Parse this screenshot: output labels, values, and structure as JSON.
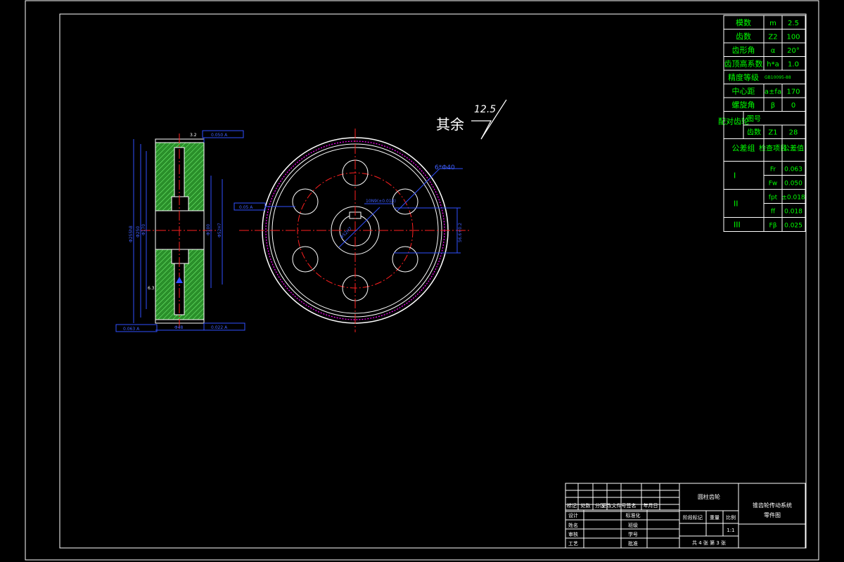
{
  "colors": {
    "background": "#000000",
    "outline": "#ffffff",
    "centerline": "#ff2020",
    "dimension": "#3050ff",
    "table_text": "#00ff00",
    "section_fill": "#33aa33",
    "addendum_circle": "#ff00ff"
  },
  "roughness": {
    "label": "其余",
    "value": "12.5"
  },
  "param_table": {
    "rows": [
      {
        "name": "模数",
        "symbol": "m",
        "value": "2.5"
      },
      {
        "name": "齿数",
        "symbol": "Z2",
        "value": "100"
      },
      {
        "name": "齿形角",
        "symbol": "α",
        "value": "20°"
      },
      {
        "name": "齿顶高系数",
        "symbol": "h*a",
        "value": "1.0"
      },
      {
        "name": "精度等级",
        "symbol": "",
        "value": "GB10095-88"
      },
      {
        "name": "中心距",
        "symbol": "a±fa",
        "value": "170"
      },
      {
        "name": "螺旋角",
        "symbol": "β",
        "value": "0"
      }
    ],
    "mating": {
      "label": "配对齿轮",
      "row1": "图号",
      "row2_name": "齿数",
      "row2_symbol": "Z1",
      "row2_value": "28"
    },
    "tolerance_header": {
      "group": "公差组",
      "item": "检查项目",
      "value": "公差值"
    },
    "groups": [
      {
        "group": "I",
        "items": [
          {
            "symbol": "Fr",
            "value": "0.063"
          },
          {
            "symbol": "Fw",
            "value": "0.050"
          }
        ]
      },
      {
        "group": "II",
        "items": [
          {
            "symbol": "fpt",
            "value": "±0.018"
          },
          {
            "symbol": "ff",
            "value": "0.018"
          }
        ]
      },
      {
        "group": "III",
        "items": [
          {
            "symbol": "Fβ",
            "value": "0.025"
          }
        ]
      }
    ]
  },
  "title_block": {
    "part_name": "圆柱齿轮",
    "project": "锥齿轮传动系统",
    "subtitle": "零件图",
    "header_cols": [
      "标记",
      "处数",
      "分区",
      "更改文件号",
      "签名",
      "年月日"
    ],
    "roles": [
      "设计",
      "姓名",
      "审核",
      "工艺"
    ],
    "role_cols2": [
      "标准化",
      "班级",
      "学号",
      "批准"
    ],
    "stage_cols": [
      "阶段标记",
      "重量",
      "比例"
    ],
    "scale": "1:1",
    "sheets": "共 4 张 第 3 张"
  },
  "dimensions": {
    "holes": "6*Φ40",
    "bore_key": "10N9(±0.018)",
    "keyway_depth": "56.6+0.2",
    "tip_diameter": "Φ255h8",
    "pitch_diameter": "Φ250",
    "hub_diameter": "Φ100",
    "hub_inner": "Φ170",
    "bore": "Φ52H7",
    "width": "Φ48",
    "runout_top": "0.050 A",
    "runout_bottom": "0.063 A",
    "runout_right": "0.022 A",
    "parallel_mid": "0.05 A",
    "datum": "A",
    "rough_side_1": "3.2",
    "rough_side_2": "6.3"
  },
  "gear": {
    "teeth": 100,
    "bolt_holes": 6
  }
}
